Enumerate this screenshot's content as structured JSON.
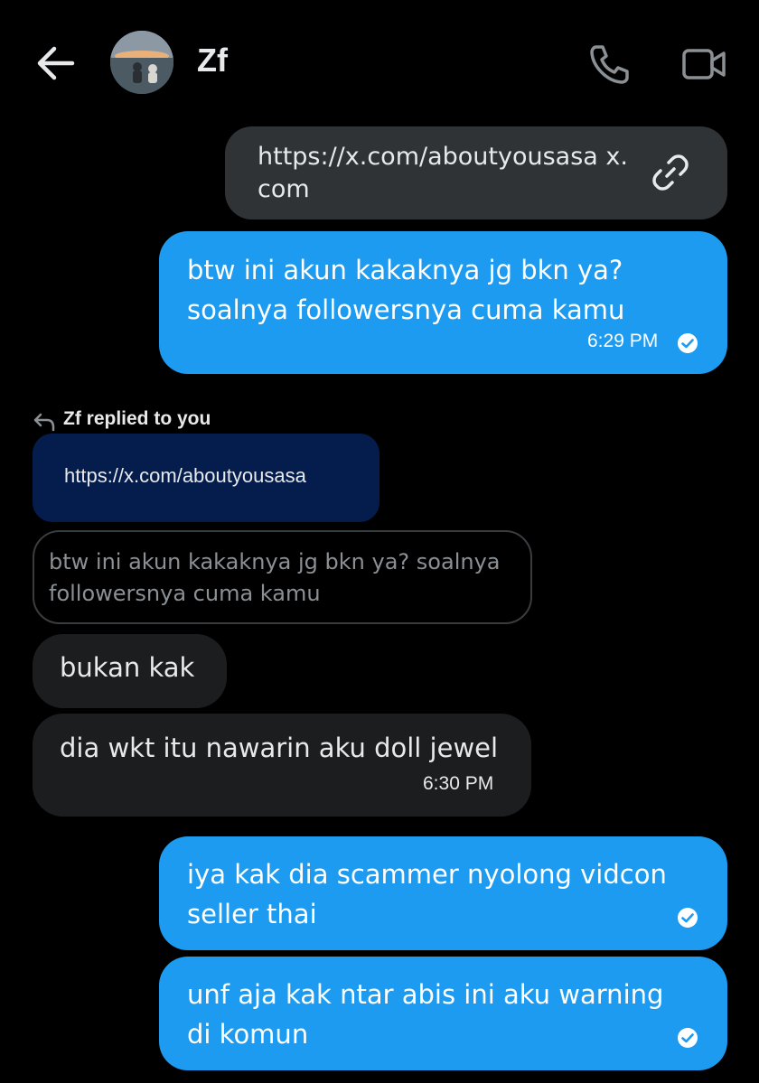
{
  "header": {
    "contact_name": "Zf"
  },
  "icons": {
    "back": "arrow-left-icon",
    "call": "phone-icon",
    "video": "video-camera-icon",
    "link": "link-icon",
    "reply": "reply-arrow-icon",
    "sent": "check-circle-icon"
  },
  "colors": {
    "background": "#000000",
    "outgoing_bubble": "#1d9bf0",
    "incoming_bubble": "#1c1d1f",
    "link_bubble": "#2f3336",
    "reply_link_bubble": "#051d4d"
  },
  "messages": {
    "link_card": {
      "url": "https://x.com/aboutyousasa x.com"
    },
    "outgoing_1": {
      "text": "btw ini akun kakaknya jg bkn ya? soalnya followersnya cuma kamu",
      "time": "6:29 PM"
    },
    "reply_context": {
      "label": "Zf replied to you",
      "link": "https://x.com/aboutyousasa",
      "quoted": "btw ini akun kakaknya jg bkn ya? soalnya followersnya cuma kamu"
    },
    "incoming_1": {
      "text": "bukan kak"
    },
    "incoming_2": {
      "text": "dia wkt itu nawarin aku doll jewel",
      "time": "6:30 PM"
    },
    "outgoing_2": {
      "text": "iya kak dia scammer nyolong vidcon seller thai"
    },
    "outgoing_3": {
      "text": "unf aja kak ntar abis ini aku warning di komun"
    }
  }
}
